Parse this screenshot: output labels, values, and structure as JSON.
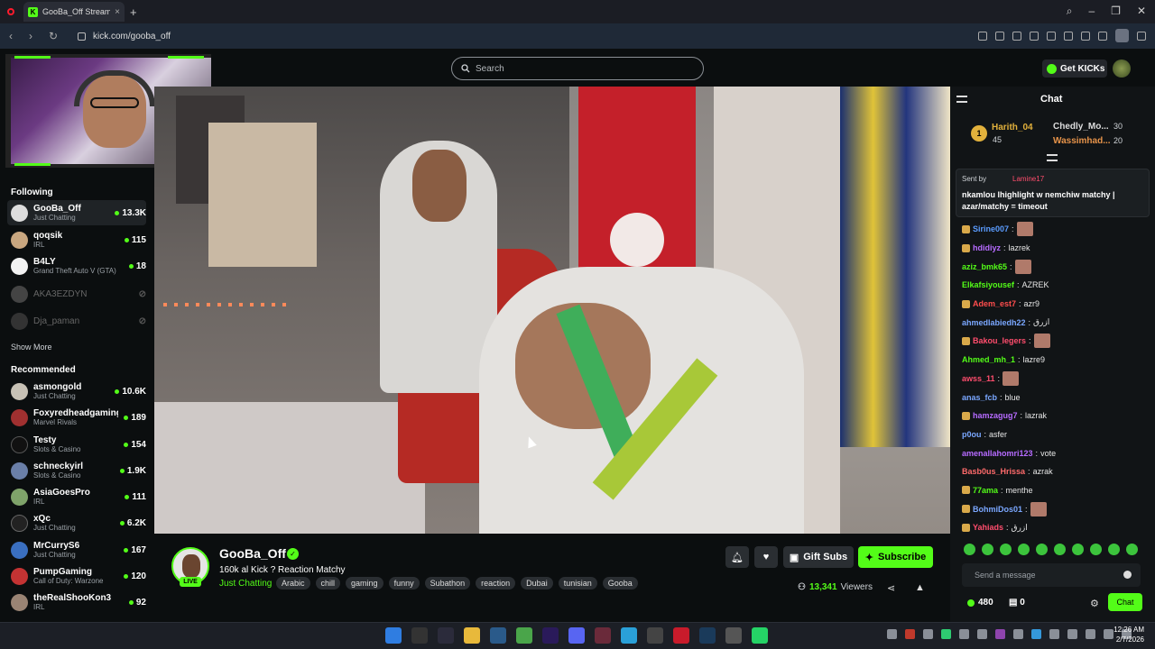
{
  "browser": {
    "tab_title": "GooBa_Off Stream - W",
    "url": "kick.com/gooba_off"
  },
  "header": {
    "search_placeholder": "Search",
    "get_kicks_label": "Get KICKs"
  },
  "sidebar": {
    "following_title": "Following",
    "following": [
      {
        "name": "GooBa_Off",
        "category": "Just Chatting",
        "viewers": "13.3K",
        "live": true
      },
      {
        "name": "qoqsik",
        "category": "IRL",
        "viewers": "115",
        "live": true
      },
      {
        "name": "B4LY",
        "category": "Grand Theft Auto V (GTA)",
        "viewers": "18",
        "live": true
      },
      {
        "name": "AKA3EZDYN",
        "category": "",
        "viewers": "",
        "live": false
      },
      {
        "name": "Dja_paman",
        "category": "",
        "viewers": "",
        "live": false
      }
    ],
    "show_more": "Show More",
    "recommended_title": "Recommended",
    "recommended": [
      {
        "name": "asmongold",
        "category": "Just Chatting",
        "viewers": "10.6K"
      },
      {
        "name": "Foxyredheadgaming",
        "category": "Marvel Rivals",
        "viewers": "189"
      },
      {
        "name": "Testy",
        "category": "Slots & Casino",
        "viewers": "154"
      },
      {
        "name": "schneckyirl",
        "category": "Slots & Casino",
        "viewers": "1.9K"
      },
      {
        "name": "AsiaGoesPro",
        "category": "IRL",
        "viewers": "111"
      },
      {
        "name": "xQc",
        "category": "Just Chatting",
        "viewers": "6.2K"
      },
      {
        "name": "MrCurryS6",
        "category": "Just Chatting",
        "viewers": "167"
      },
      {
        "name": "PumpGaming",
        "category": "Call of Duty: Warzone",
        "viewers": "120"
      },
      {
        "name": "theRealShooKon3",
        "category": "IRL",
        "viewers": "92"
      }
    ]
  },
  "stream": {
    "live_badge": "LIVE",
    "streamer": "GooBa_Off",
    "title": "160k al Kick ? Reaction Matchy",
    "category": "Just Chatting",
    "tags": [
      "Arabic",
      "chill",
      "gaming",
      "funny",
      "Subathon",
      "reaction",
      "Dubai",
      "tunisian",
      "Gooba"
    ],
    "gift_label": "Gift Subs",
    "subscribe_label": "Subscribe",
    "viewers": "13,341",
    "viewers_label": "Viewers"
  },
  "chat": {
    "title": "Chat",
    "leaderboard": [
      {
        "rank": "1",
        "name": "Harith_04",
        "points": "45"
      },
      {
        "name": "Chedly_Mo...",
        "points": "30"
      },
      {
        "name": "Wassimhad...",
        "points": "20"
      }
    ],
    "pinned": {
      "sent_by_label": "Sent by",
      "user": "Lamine17",
      "message": "nkamlou lhighlight w nemchiw matchy | azar/matchy = timeout"
    },
    "messages": [
      {
        "user": "Sirine007",
        "text": "",
        "color": "#5b9cff",
        "badge": true,
        "emote": true
      },
      {
        "user": "hdidiyz",
        "text": "lazrek",
        "color": "#b66bff",
        "badge": true,
        "emote": false
      },
      {
        "user": "aziz_bmk65",
        "text": "",
        "color": "#53fc18",
        "badge": false,
        "emote": true
      },
      {
        "user": "Elkafsiyousef",
        "text": "AZREK",
        "color": "#53fc18",
        "badge": false,
        "emote": false
      },
      {
        "user": "Adem_est7",
        "text": "azr9",
        "color": "#ff4d4d",
        "badge": true,
        "emote": false
      },
      {
        "user": "ahmedlabiedh22",
        "text": "ازرق",
        "color": "#7aa7ff",
        "badge": false,
        "emote": false
      },
      {
        "user": "Bakou_legers",
        "text": "",
        "color": "#ff4d6d",
        "badge": true,
        "emote": true
      },
      {
        "user": "Ahmed_mh_1",
        "text": "lazre9",
        "color": "#53fc18",
        "badge": false,
        "emote": false
      },
      {
        "user": "awss_11",
        "text": "",
        "color": "#ff4d6d",
        "badge": false,
        "emote": true
      },
      {
        "user": "anas_fcb",
        "text": "blue",
        "color": "#7aa7ff",
        "badge": false,
        "emote": false
      },
      {
        "user": "hamzagug7",
        "text": "lazrak",
        "color": "#b66bff",
        "badge": true,
        "emote": false
      },
      {
        "user": "p0ou",
        "text": "asfer",
        "color": "#7aa7ff",
        "badge": false,
        "emote": false
      },
      {
        "user": "amenallahomri123",
        "text": "vote",
        "color": "#b66bff",
        "badge": false,
        "emote": false
      },
      {
        "user": "Basb0us_Hrissa",
        "text": "azrak",
        "color": "#ff6b6b",
        "badge": false,
        "emote": false
      },
      {
        "user": "77ama",
        "text": "menthe",
        "color": "#53fc18",
        "badge": true,
        "emote": false
      },
      {
        "user": "BohmiDos01",
        "text": "",
        "color": "#7aa7ff",
        "badge": true,
        "emote": true
      },
      {
        "user": "Yahiads",
        "text": "ازرق",
        "color": "#ff4d6d",
        "badge": true,
        "emote": false
      }
    ],
    "send_placeholder": "Send a message",
    "points": "480",
    "box_count": "0",
    "chat_button": "Chat"
  },
  "system": {
    "time": "12:26 AM",
    "date": "2/7/2026"
  },
  "colors": {
    "accent": "#53fc18",
    "bg": "#0b0e0f"
  }
}
